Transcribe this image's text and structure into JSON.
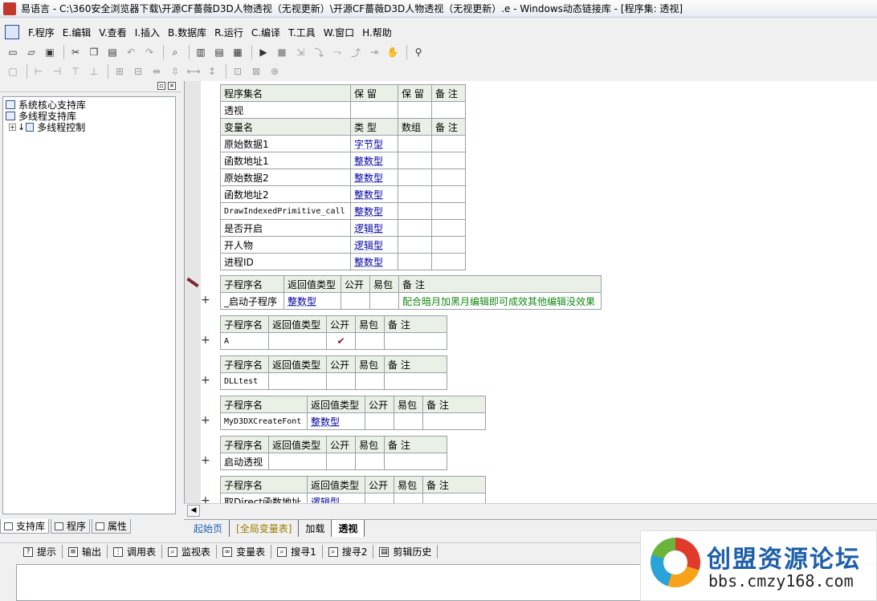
{
  "window": {
    "title": "易语言 - C:\\360安全浏览器下载\\开源CF薔薇D3D人物透视（无视更新）\\开源CF薔薇D3D人物透视（无视更新）.e - Windows动态链接库 - [程序集: 透视]"
  },
  "menu": [
    "F.程序",
    "E.编辑",
    "V.查看",
    "I.插入",
    "B.数据库",
    "R.运行",
    "C.编译",
    "T.工具",
    "W.窗口",
    "H.帮助"
  ],
  "left_panel": {
    "tree": [
      {
        "label": "系统核心支持库"
      },
      {
        "label": "多线程支持库"
      },
      {
        "label": "多线程控制",
        "expand": "+"
      }
    ],
    "tabs": [
      "支持库",
      "程序",
      "属性"
    ]
  },
  "assembly_table": {
    "header": [
      "程序集名",
      "保 留",
      "保 留",
      "备 注"
    ],
    "name": "透视",
    "var_header": [
      "变量名",
      "类 型",
      "数组",
      "备 注"
    ],
    "vars": [
      {
        "name": "原始数据1",
        "type": "字节型"
      },
      {
        "name": "函数地址1",
        "type": "整数型"
      },
      {
        "name": "原始数据2",
        "type": "整数型"
      },
      {
        "name": "函数地址2",
        "type": "整数型"
      },
      {
        "name": "DrawIndexedPrimitive_call",
        "type": "整数型"
      },
      {
        "name": "是否开启",
        "type": "逻辑型"
      },
      {
        "name": "开人物",
        "type": "逻辑型"
      },
      {
        "name": "进程ID",
        "type": "整数型"
      }
    ]
  },
  "sub_header": [
    "子程序名",
    "返回值类型",
    "公开",
    "易包",
    "备 注"
  ],
  "subs": [
    {
      "name": "_启动子程序",
      "ret": "整数型",
      "pub": "",
      "note": "配合暗月加黑月编辑即可成效其他编辑没效果"
    },
    {
      "name": "A",
      "ret": "",
      "pub": "✔",
      "note": ""
    },
    {
      "name": "DLLtest",
      "ret": "",
      "pub": "",
      "note": ""
    },
    {
      "name": "MyD3DXCreateFont",
      "ret": "整数型",
      "pub": "",
      "note": ""
    },
    {
      "name": "启动透视",
      "ret": "",
      "pub": "",
      "note": ""
    },
    {
      "name": "取Direct函数地址",
      "ret": "逻辑型",
      "pub": "",
      "note": ""
    }
  ],
  "doc_tabs": [
    "起始页",
    "[全局变量表]",
    "加载",
    "透视"
  ],
  "bottom_tabs": [
    "提示",
    "输出",
    "调用表",
    "监视表",
    "变量表",
    "搜寻1",
    "搜寻2",
    "剪辑历史"
  ],
  "watermark": {
    "title": "创盟资源论坛",
    "url": "bbs.cmzy168.com"
  }
}
